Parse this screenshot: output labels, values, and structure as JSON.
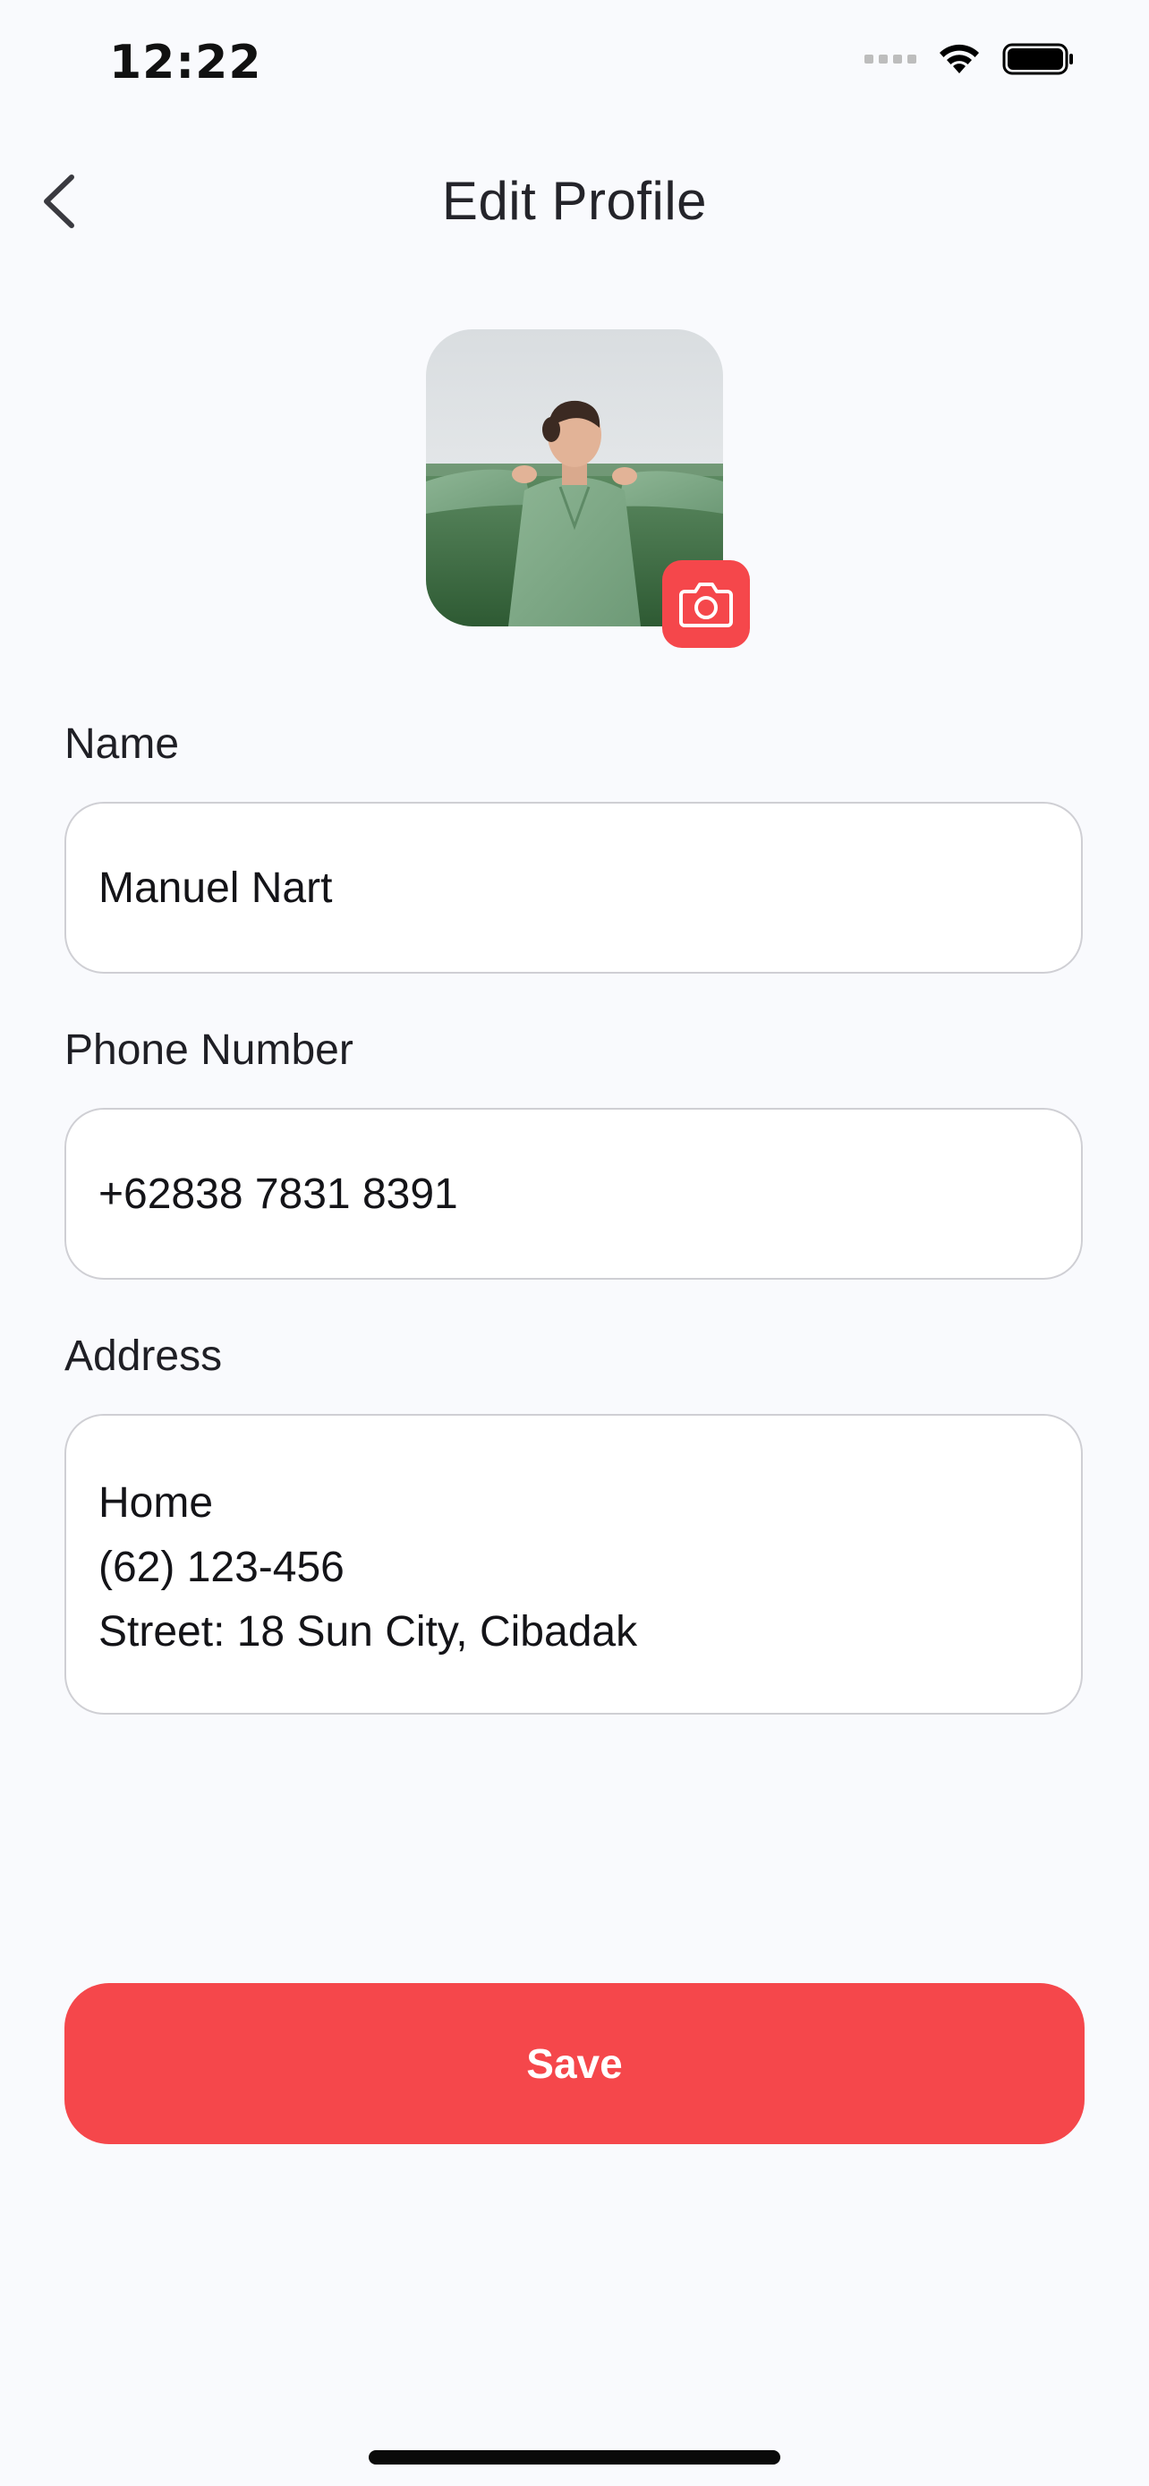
{
  "status_bar": {
    "time": "12:22"
  },
  "header": {
    "title": "Edit Profile",
    "back_icon": "chevron-left-icon"
  },
  "profile": {
    "photo": "profile-photo (woman in green shirt in a field)",
    "camera_icon": "camera-icon"
  },
  "form": {
    "name_label": "Name",
    "name_value": "Manuel Nart",
    "phone_label": "Phone Number",
    "phone_value": "+62838 7831 8391",
    "address_label": "Address",
    "address_lines": [
      "Home",
      "(62) 123-456",
      "Street: 18 Sun City, Cibadak"
    ]
  },
  "actions": {
    "save_label": "Save"
  },
  "colors": {
    "accent": "#F5474B",
    "background": "#F9FAFD",
    "field_border": "#CFCFD4",
    "text": "#1E1E24"
  }
}
